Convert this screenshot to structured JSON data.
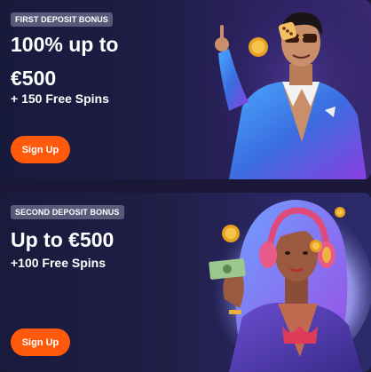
{
  "banners": [
    {
      "badge": "FIRST DEPOSIT BONUS",
      "headline_line1": "100% up to",
      "headline_line2": "€500",
      "subline": "+ 150 Free Spins",
      "cta": "Sign Up"
    },
    {
      "badge": "SECOND DEPOSIT BONUS",
      "headline_line1": "Up to €500",
      "subline": "+100 Free Spins",
      "cta": "Sign Up"
    }
  ],
  "colors": {
    "cta": "#ff5a0c",
    "badge_bg": "#59597a",
    "background": "#1b1736"
  },
  "icons": [
    "coin-icon",
    "dice-icon",
    "dollar-bill-icon"
  ]
}
